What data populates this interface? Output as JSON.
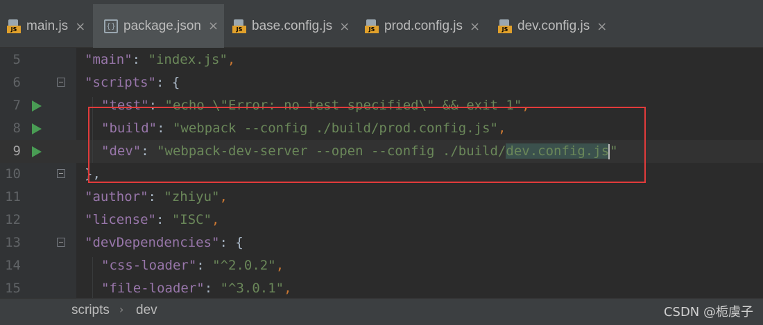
{
  "tabs": [
    {
      "label": "main.js",
      "icon": "js-file-icon"
    },
    {
      "label": "package.json",
      "icon": "json-file-icon",
      "active": true
    },
    {
      "label": "base.config.js",
      "icon": "js-file-icon"
    },
    {
      "label": "prod.config.js",
      "icon": "js-file-icon"
    },
    {
      "label": "dev.config.js",
      "icon": "js-file-icon"
    }
  ],
  "close_glyph": "×",
  "lines": [
    {
      "num": "5",
      "tokens": [
        [
          "\"main\"",
          "k"
        ],
        [
          ": ",
          "w"
        ],
        [
          "\"index.js\"",
          "s"
        ],
        [
          ",",
          "p"
        ]
      ]
    },
    {
      "num": "6",
      "tokens": [
        [
          "\"scripts\"",
          "k"
        ],
        [
          ": {",
          "w"
        ]
      ]
    },
    {
      "num": "7",
      "tokens": [
        [
          "\"test\"",
          "k"
        ],
        [
          ": ",
          "w"
        ],
        [
          "\"echo \\\"Error: no test specified\\\" && exit 1\"",
          "s"
        ],
        [
          ",",
          "p"
        ]
      ]
    },
    {
      "num": "8",
      "tokens": [
        [
          "\"build\"",
          "k"
        ],
        [
          ": ",
          "w"
        ],
        [
          "\"webpack --config ./build/prod.config.js\"",
          "s"
        ],
        [
          ",",
          "p"
        ]
      ]
    },
    {
      "num": "9",
      "tokens": [
        [
          "\"dev\"",
          "k"
        ],
        [
          ": ",
          "w"
        ],
        [
          "\"webpack-dev-server --open --config ./build/",
          "s"
        ],
        [
          "dev.config.js",
          "s"
        ],
        [
          "\"",
          "s"
        ]
      ]
    },
    {
      "num": "10",
      "tokens": [
        [
          "},",
          "w"
        ]
      ]
    },
    {
      "num": "11",
      "tokens": [
        [
          "\"author\"",
          "k"
        ],
        [
          ": ",
          "w"
        ],
        [
          "\"zhiyu\"",
          "s"
        ],
        [
          ",",
          "p"
        ]
      ]
    },
    {
      "num": "12",
      "tokens": [
        [
          "\"license\"",
          "k"
        ],
        [
          ": ",
          "w"
        ],
        [
          "\"ISC\"",
          "s"
        ],
        [
          ",",
          "p"
        ]
      ]
    },
    {
      "num": "13",
      "tokens": [
        [
          "\"devDependencies\"",
          "k"
        ],
        [
          ": {",
          "w"
        ]
      ]
    },
    {
      "num": "14",
      "tokens": [
        [
          "\"css-loader\"",
          "k"
        ],
        [
          ": ",
          "w"
        ],
        [
          "\"^2.0.2\"",
          "s"
        ],
        [
          ",",
          "p"
        ]
      ]
    },
    {
      "num": "15",
      "tokens": [
        [
          "\"file-loader\"",
          "k"
        ],
        [
          ": ",
          "w"
        ],
        [
          "\"^3.0.1\"",
          "s"
        ],
        [
          ",",
          "p"
        ]
      ]
    }
  ],
  "breadcrumb": {
    "part1": "scripts",
    "separator": "›",
    "part2": "dev"
  },
  "watermark": "CSDN @栀虞子",
  "colors": {
    "key": "#9876aa",
    "string": "#6a8759",
    "punct": "#cc7832",
    "highlight_box": "#e23b3b",
    "run": "#499c54"
  }
}
